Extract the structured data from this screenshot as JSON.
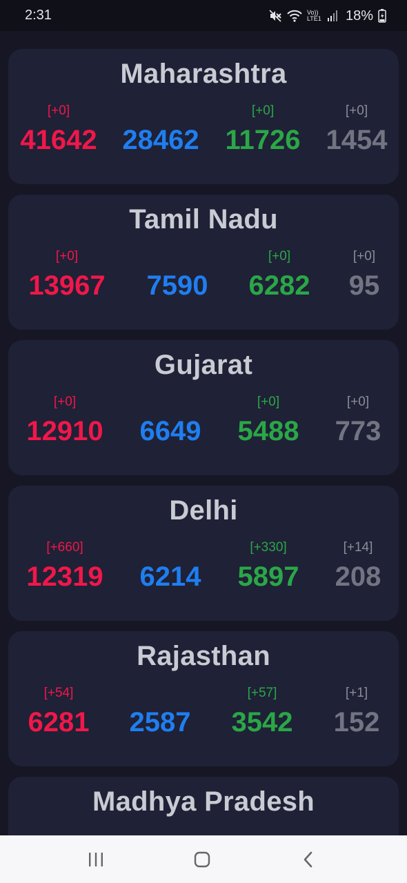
{
  "status_bar": {
    "time": "2:31",
    "network_label": "Vo)) LTE1",
    "battery": "18%",
    "icons": [
      "mute-icon",
      "wifi-icon",
      "signal-icon",
      "battery-icon"
    ]
  },
  "colors": {
    "confirmed": "#f0174a",
    "active": "#1f7ef0",
    "recovered": "#2aa747",
    "deceased": "#727581"
  },
  "states": [
    {
      "name": "Maharashtra",
      "confirmed": {
        "delta": "[+0]",
        "value": "41642"
      },
      "active": {
        "delta": "",
        "value": "28462"
      },
      "recovered": {
        "delta": "[+0]",
        "value": "11726"
      },
      "deceased": {
        "delta": "[+0]",
        "value": "1454"
      }
    },
    {
      "name": "Tamil Nadu",
      "confirmed": {
        "delta": "[+0]",
        "value": "13967"
      },
      "active": {
        "delta": "",
        "value": "7590"
      },
      "recovered": {
        "delta": "[+0]",
        "value": "6282"
      },
      "deceased": {
        "delta": "[+0]",
        "value": "95"
      }
    },
    {
      "name": "Gujarat",
      "confirmed": {
        "delta": "[+0]",
        "value": "12910"
      },
      "active": {
        "delta": "",
        "value": "6649"
      },
      "recovered": {
        "delta": "[+0]",
        "value": "5488"
      },
      "deceased": {
        "delta": "[+0]",
        "value": "773"
      }
    },
    {
      "name": "Delhi",
      "confirmed": {
        "delta": "[+660]",
        "value": "12319"
      },
      "active": {
        "delta": "",
        "value": "6214"
      },
      "recovered": {
        "delta": "[+330]",
        "value": "5897"
      },
      "deceased": {
        "delta": "[+14]",
        "value": "208"
      }
    },
    {
      "name": "Rajasthan",
      "confirmed": {
        "delta": "[+54]",
        "value": "6281"
      },
      "active": {
        "delta": "",
        "value": "2587"
      },
      "recovered": {
        "delta": "[+57]",
        "value": "3542"
      },
      "deceased": {
        "delta": "[+1]",
        "value": "152"
      }
    },
    {
      "name": "Madhya Pradesh"
    }
  ],
  "nav_bar": {
    "buttons": [
      "recent-apps-button",
      "home-button",
      "back-button"
    ]
  }
}
